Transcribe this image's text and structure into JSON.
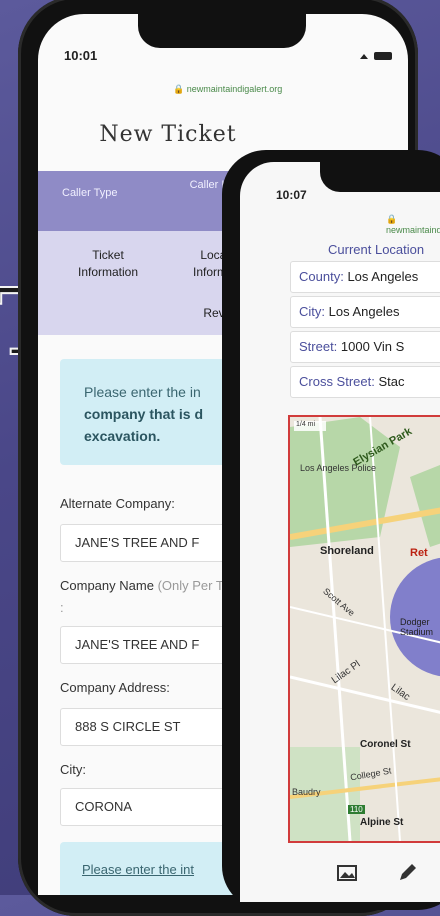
{
  "background_letter": "T",
  "phone1": {
    "time": "10:01",
    "url": "newmaintaindigalert.org",
    "title": "New Ticket",
    "steps": [
      "Caller Type",
      "Caller Information"
    ],
    "substeps": [
      "Ticket Information",
      "Location Information",
      "Review"
    ],
    "info_text_1": "Please enter the in",
    "info_text_bold": "company that is d",
    "info_text_bold2": "excavation.",
    "fields": [
      {
        "label": "Alternate Company:",
        "value": "JANE'S TREE AND F"
      },
      {
        "label": "Company Name",
        "label_muted": "(Only Per Ticket) :",
        "value": "JANE'S TREE AND F"
      },
      {
        "label": "Company Address:",
        "value": "888 S CIRCLE ST"
      },
      {
        "label": "City:",
        "value": "CORONA"
      }
    ],
    "info_text_2": "Please enter the int"
  },
  "phone2": {
    "time": "10:07",
    "url": "newmaintaindigalert.org",
    "location_heading": "Current Location",
    "county_label": "County:",
    "county_value": "Los Angeles",
    "city_label": "City:",
    "city_value": "Los Angeles",
    "street_label": "Street:",
    "street_value": "1000 Vin S",
    "cross_label": "Cross Street:",
    "cross_value": "Stac",
    "map_labels": {
      "scale": "1/4 mi",
      "police": "Los Angeles Police",
      "park": "Elysian Park",
      "shoreland": "Shoreland",
      "ret": "Ret",
      "scott": "Scott Ave",
      "lilac_pl": "Lilac Pl",
      "lilac": "Lilac",
      "coronel": "Coronel St",
      "college": "College St",
      "alpine": "Alpine St",
      "baudry": "Baudry",
      "dodger": "Dodger Stadium",
      "route": "110"
    }
  },
  "colors": {
    "accent": "#8f8bc6",
    "heading": "#4b4f9c",
    "info_bg": "#d2eef5",
    "highlight": "#6f6cc8"
  }
}
